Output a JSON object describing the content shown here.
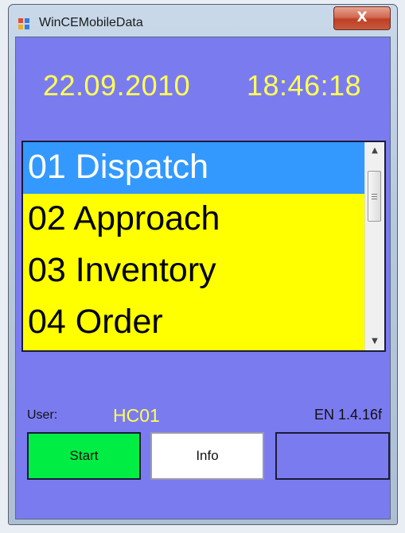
{
  "window": {
    "title": "WinCEMobileData",
    "close_glyph": "X"
  },
  "header": {
    "date": "22.09.2010",
    "time": "18:46:18"
  },
  "list": {
    "items": [
      {
        "label": "01 Dispatch",
        "selected": true
      },
      {
        "label": "02 Approach",
        "selected": false
      },
      {
        "label": "03 Inventory",
        "selected": false
      },
      {
        "label": "04 Order",
        "selected": false
      }
    ],
    "scroll_up_glyph": "▲",
    "scroll_down_glyph": "▼"
  },
  "footer": {
    "user_label": "User:",
    "user_value": "HC01",
    "version": "EN 1.4.16f",
    "start_label": "Start",
    "info_label": "Info",
    "empty_label": ""
  },
  "colors": {
    "client_bg": "#7b7bf0",
    "accent_text": "#ffff55",
    "list_bg": "#ffff00",
    "selected_bg": "#3399ff",
    "start_bg": "#00ee44"
  },
  "icons": {
    "app": "app-icon",
    "close": "close-icon"
  }
}
